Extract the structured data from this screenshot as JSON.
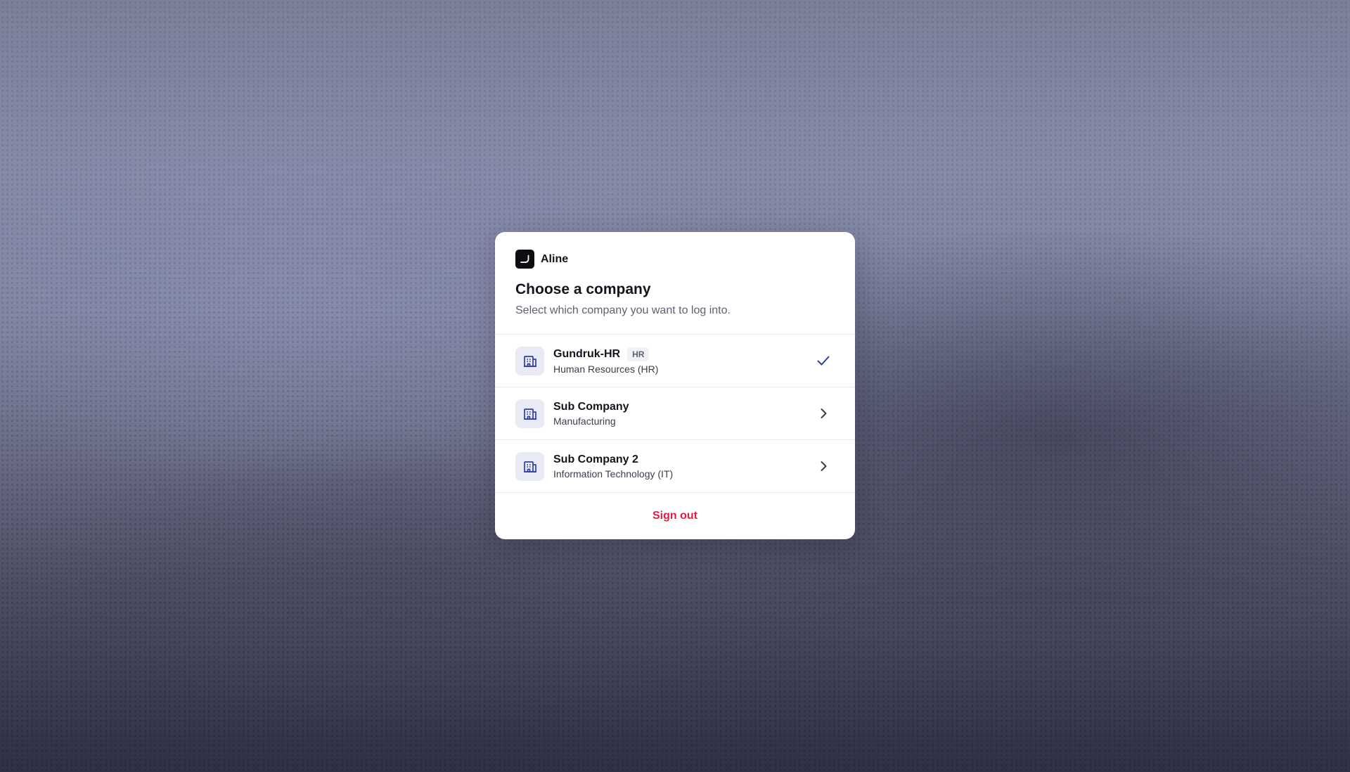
{
  "app": {
    "name": "Aline",
    "logo_icon": "aline-logo-icon"
  },
  "dialog": {
    "title": "Choose a company",
    "subtitle": "Select which company you want to log into."
  },
  "companies": [
    {
      "name": "Gundruk-HR",
      "badge": "HR",
      "department": "Human Resources (HR)",
      "icon": "building-icon",
      "selected": true,
      "trailing_icon": "check-icon"
    },
    {
      "name": "Sub Company",
      "department": "Manufacturing",
      "icon": "building-icon",
      "selected": false,
      "trailing_icon": "chevron-right-icon"
    },
    {
      "name": "Sub Company 2",
      "department": "Information Technology (IT)",
      "icon": "building-icon",
      "selected": false,
      "trailing_icon": "chevron-right-icon"
    }
  ],
  "footer": {
    "sign_out_label": "Sign out"
  },
  "colors": {
    "accent": "#2f3fa8",
    "icon_bg": "#e8eaf6",
    "danger": "#e11d3f",
    "text_primary": "#14151c",
    "text_secondary": "#5d6172"
  }
}
